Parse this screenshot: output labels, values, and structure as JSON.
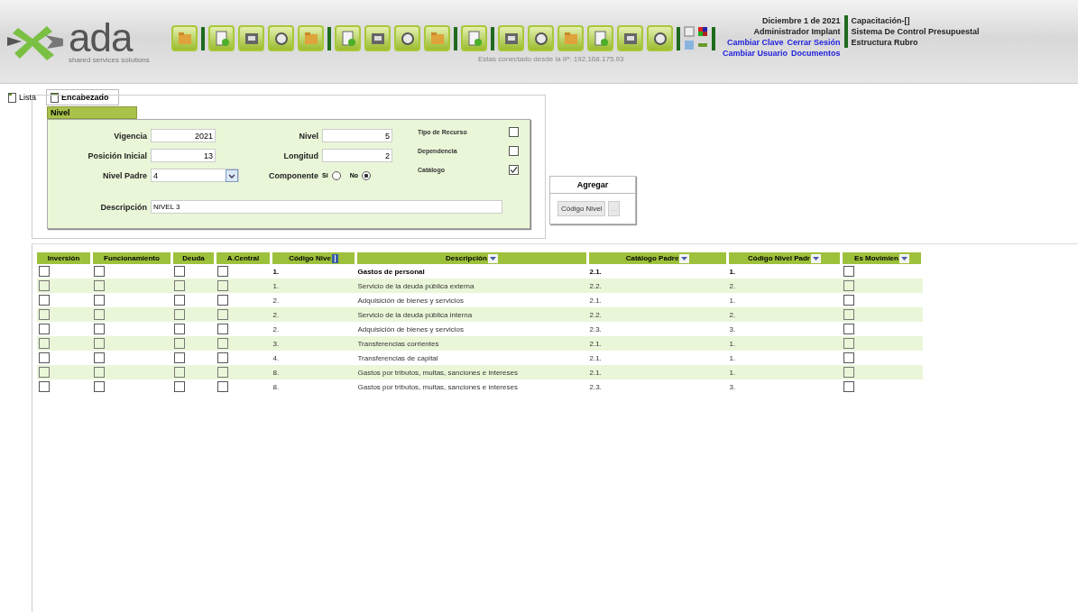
{
  "header": {
    "logo": "ada",
    "tagline": "shared services solutions",
    "ip_notice": "Estas conectado desde la IP: 192.168.175.93",
    "date": "Diciembre 1 de 2021",
    "user": "Administrador Implant",
    "links_row1": [
      "Cambiar Clave",
      "Cerrar Sesión"
    ],
    "links_row2": [
      "Cambiar Usuario",
      "Documentos"
    ],
    "context": [
      "Capacitación-[]",
      "Sistema De Control Presupuestal",
      "Estructura Rubro"
    ]
  },
  "tabs": [
    {
      "label": "Lista",
      "selected": false
    },
    {
      "label": "Encabezado",
      "selected": true
    }
  ],
  "form": {
    "section": "Nivel",
    "fields": [
      {
        "label": "Vigencia",
        "value": "2021"
      },
      {
        "label": "Nivel",
        "value": "5"
      },
      {
        "label": "Posición Inicial",
        "value": "13"
      },
      {
        "label": "Longitud",
        "value": "2"
      }
    ],
    "parent_level": {
      "label": "Nivel Padre",
      "value": "4"
    },
    "component": {
      "label": "Componente",
      "options": [
        {
          "label": "Si",
          "selected": false
        },
        {
          "label": "No",
          "selected": true
        }
      ]
    },
    "checks": [
      {
        "label": "Tipo de Recurso",
        "checked": false
      },
      {
        "label": "Dependencia",
        "checked": false
      },
      {
        "label": "Catálogo",
        "checked": true
      }
    ],
    "description": {
      "label": "Descripción",
      "value": "NIVEL 3"
    }
  },
  "add_panel": {
    "title": "Agregar",
    "button": "Código Nivel",
    "more": "..."
  },
  "table": {
    "columns": [
      {
        "label": "Inversión",
        "kind": "check",
        "filter": false
      },
      {
        "label": "Funcionamiento",
        "kind": "check",
        "filter": false
      },
      {
        "label": "Deuda",
        "kind": "check",
        "filter": false
      },
      {
        "label": "A.Central",
        "kind": "check",
        "filter": false
      },
      {
        "label": "Código Nive",
        "kind": "text",
        "filter": false,
        "sorted": true
      },
      {
        "label": "Descripción",
        "kind": "text",
        "filter": true
      },
      {
        "label": "Catálogo Padre",
        "kind": "text",
        "filter": true
      },
      {
        "label": "Código Nivel Padr",
        "kind": "text",
        "filter": true
      },
      {
        "label": "Es Movimien",
        "kind": "check",
        "filter": true
      }
    ],
    "rows": [
      {
        "selected": true,
        "cells": [
          false,
          false,
          false,
          false,
          "1.",
          "Gastos de personal",
          "2.1.",
          "1.",
          false
        ]
      },
      {
        "selected": false,
        "cells": [
          false,
          false,
          false,
          false,
          "1.",
          "Servicio de la deuda pública externa",
          "2.2.",
          "2.",
          false
        ]
      },
      {
        "selected": false,
        "cells": [
          false,
          false,
          false,
          false,
          "2.",
          "Adquisición de bienes y servicios",
          "2.1.",
          "1.",
          false
        ]
      },
      {
        "selected": false,
        "cells": [
          false,
          false,
          false,
          false,
          "2.",
          "Servicio de la deuda pública interna",
          "2.2.",
          "2.",
          false
        ]
      },
      {
        "selected": false,
        "cells": [
          false,
          false,
          false,
          false,
          "2.",
          "Adquisición de bienes y servicios",
          "2.3.",
          "3.",
          false
        ]
      },
      {
        "selected": false,
        "cells": [
          false,
          false,
          false,
          false,
          "3.",
          "Transferencias corrientes",
          "2.1.",
          "1.",
          false
        ]
      },
      {
        "selected": false,
        "cells": [
          false,
          false,
          false,
          false,
          "4.",
          "Transferencias de capital",
          "2.1.",
          "1.",
          false
        ]
      },
      {
        "selected": false,
        "cells": [
          false,
          false,
          false,
          false,
          "8.",
          "Gastos por tributos, multas, sanciones e intereses",
          "2.1.",
          "1.",
          false
        ]
      },
      {
        "selected": false,
        "cells": [
          false,
          false,
          false,
          false,
          "8.",
          "Gastos por tributos, multas, sanciones e intereses",
          "2.3.",
          "3.",
          false
        ]
      }
    ]
  }
}
